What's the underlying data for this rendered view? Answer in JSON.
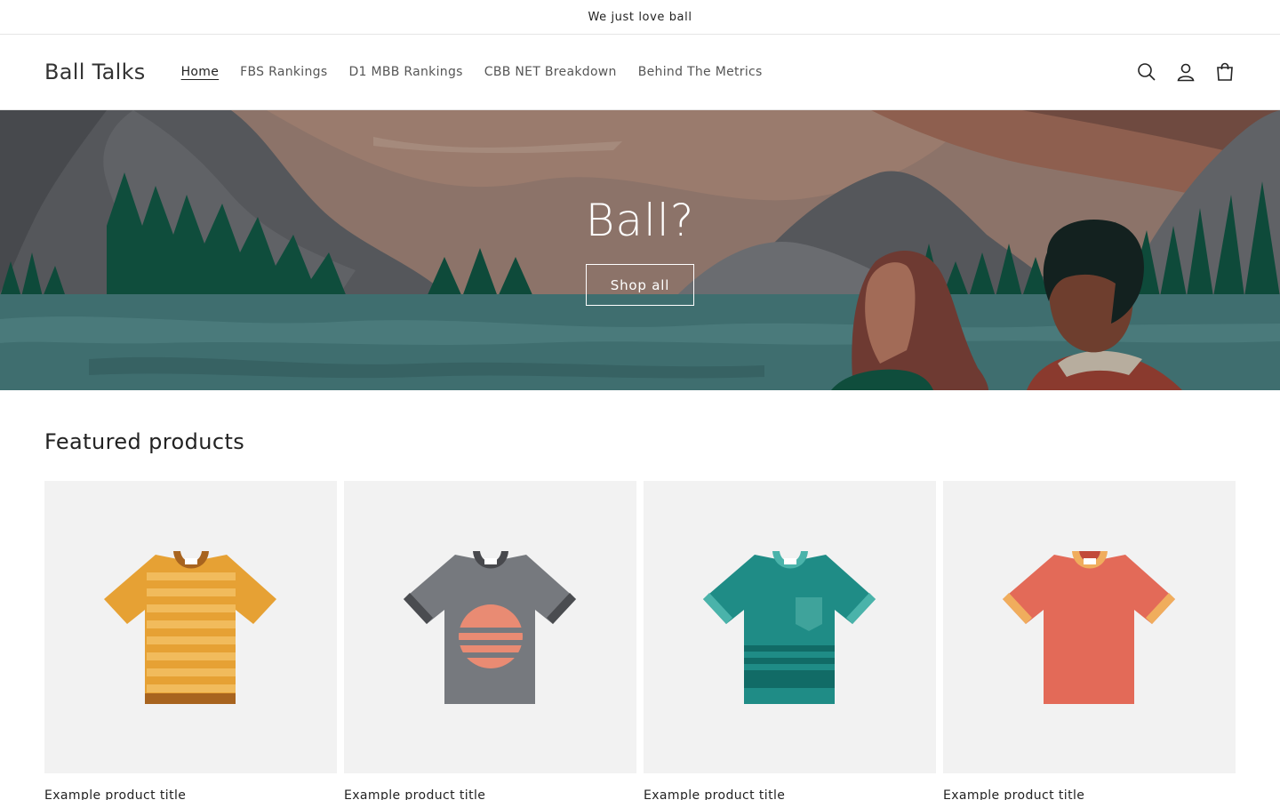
{
  "announcement": {
    "text": "We just love ball"
  },
  "header": {
    "logo": "Ball Talks",
    "nav": [
      {
        "label": "Home",
        "active": true
      },
      {
        "label": "FBS Rankings",
        "active": false
      },
      {
        "label": "D1 MBB Rankings",
        "active": false
      },
      {
        "label": "CBB NET Breakdown",
        "active": false
      },
      {
        "label": "Behind The Metrics",
        "active": false
      }
    ],
    "icons": [
      "search-icon",
      "account-icon",
      "cart-icon"
    ]
  },
  "hero": {
    "title": "Ball?",
    "button_label": "Shop all"
  },
  "featured": {
    "heading": "Featured products",
    "products": [
      {
        "title": "Example product title",
        "shirt": "orange-striped"
      },
      {
        "title": "Example product title",
        "shirt": "gray-sunset"
      },
      {
        "title": "Example product title",
        "shirt": "teal-pocket"
      },
      {
        "title": "Example product title",
        "shirt": "coral-plain"
      }
    ]
  },
  "colors": {
    "sky": "#8a7169",
    "water": "#3d6b6c",
    "trees": "#0e4a3a",
    "mountain": "#56585c",
    "card_bg": "#f2f2f2"
  }
}
